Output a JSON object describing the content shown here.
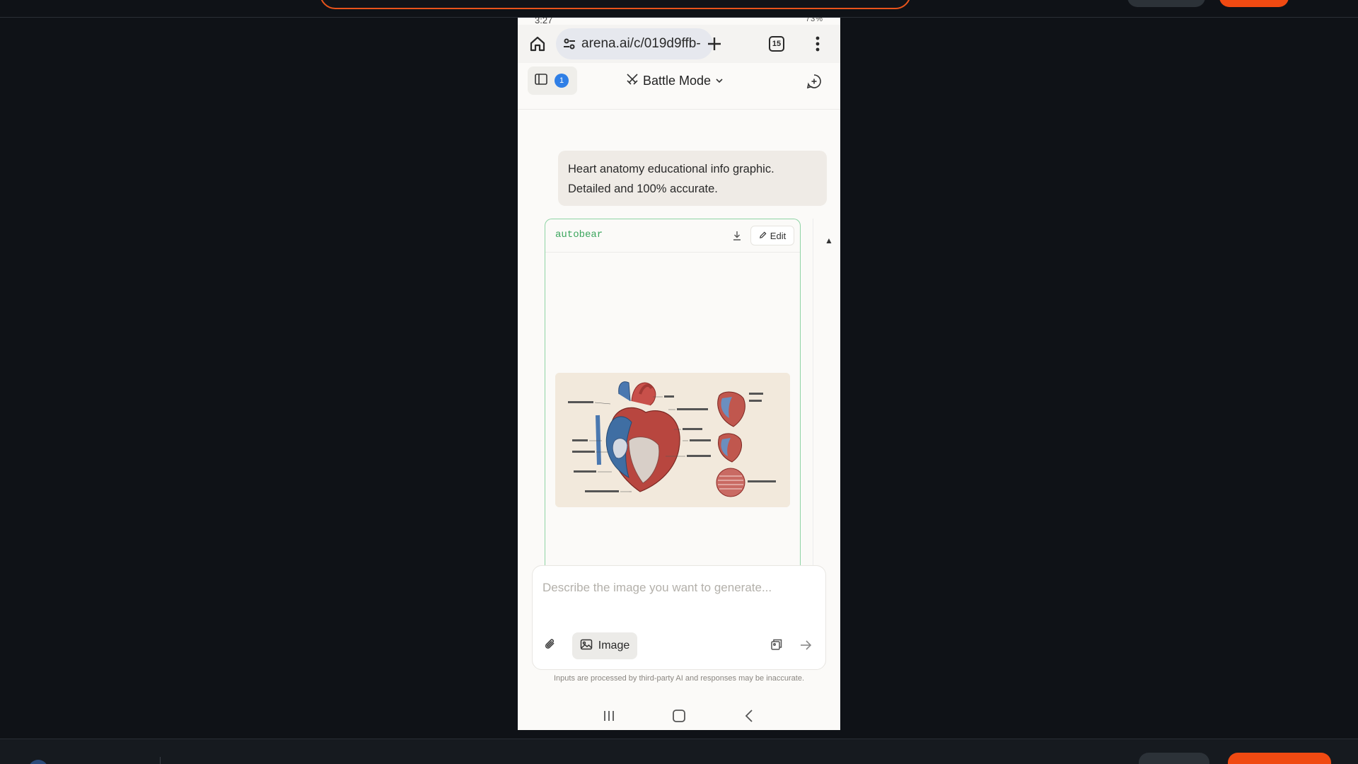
{
  "status_bar": {
    "time": "3:27",
    "right": "73%"
  },
  "browser": {
    "url": "arena.ai/c/019d9ffb-",
    "tab_count": "15",
    "icons": [
      "home-icon",
      "site-settings-icon",
      "new-tab-icon",
      "tabs-icon",
      "more-icon"
    ]
  },
  "header": {
    "sidebar_badge": "1",
    "mode_label": "Battle Mode",
    "icons": [
      "sidebar-icon",
      "swords-icon",
      "chevron-down-icon",
      "new-chat-icon"
    ]
  },
  "conversation": {
    "user_prompt": "Heart anatomy educational info graphic. Detailed and 100% accurate.",
    "responses": [
      {
        "model": "autobear",
        "edit_label": "Edit",
        "image_alt": "heart-anatomy-infographic"
      }
    ]
  },
  "composer": {
    "placeholder": "Describe the image you want to generate...",
    "image_button_label": "Image",
    "disclaimer": "Inputs are processed by third-party AI and responses may be inaccurate."
  },
  "colors": {
    "accent_green": "#3aa55c",
    "card_border": "#8fd4a5",
    "badge_blue": "#2f7fe6",
    "stream_orange": "#f04a12"
  }
}
